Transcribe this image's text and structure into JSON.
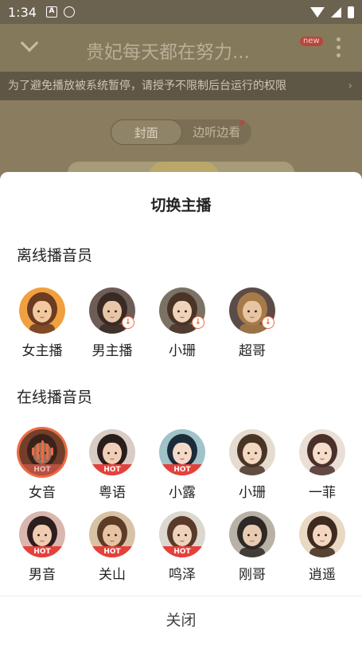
{
  "status": {
    "time": "1:34"
  },
  "header": {
    "title": "贵妃每天都在努力...",
    "badge": "new"
  },
  "notice": {
    "text": "为了避免播放被系统暂停，请授予不限制后台运行的权限",
    "arrow": "›"
  },
  "toggle": {
    "tab1": "封面",
    "tab2": "边听边看"
  },
  "sheet": {
    "title": "切换主播",
    "offline_title": "离线播音员",
    "online_title": "在线播音员",
    "hot_label": "HOT",
    "close_label": "关闭",
    "offline": [
      {
        "name": "女主播",
        "download": false,
        "skin": "#f2c89e",
        "hair": "#6b3b22",
        "bg": "#f0a040"
      },
      {
        "name": "男主播",
        "download": true,
        "skin": "#e8c7a8",
        "hair": "#3a2a24",
        "bg": "#6e5c57"
      },
      {
        "name": "小珊",
        "download": true,
        "skin": "#efd3bb",
        "hair": "#4a3428",
        "bg": "#7a7265"
      },
      {
        "name": "超哥",
        "download": true,
        "skin": "#e6c5a3",
        "hair": "#a77a4a",
        "bg": "#5b4c48"
      }
    ],
    "online": [
      {
        "name": "女音",
        "hot": true,
        "selected": true,
        "skin": "#e6b59a",
        "hair": "#3a2620",
        "bg": "#a05a3c"
      },
      {
        "name": "粤语",
        "hot": true,
        "selected": false,
        "skin": "#f0cfb8",
        "hair": "#2a1e1c",
        "bg": "#d8ccc5"
      },
      {
        "name": "小露",
        "hot": true,
        "selected": false,
        "skin": "#f4d9c9",
        "hair": "#1c2a3a",
        "bg": "#9fc3c8"
      },
      {
        "name": "小珊",
        "hot": false,
        "selected": false,
        "skin": "#f2d8c1",
        "hair": "#4a3426",
        "bg": "#e4ddcf"
      },
      {
        "name": "一菲",
        "hot": false,
        "selected": false,
        "skin": "#f5dccb",
        "hair": "#4a302a",
        "bg": "#e9dfd7"
      },
      {
        "name": "男音",
        "hot": true,
        "selected": false,
        "skin": "#efcbb2",
        "hair": "#2c1e1c",
        "bg": "#d9b7ae"
      },
      {
        "name": "关山",
        "hot": true,
        "selected": false,
        "skin": "#e6c3a2",
        "hair": "#5c3c26",
        "bg": "#d8c2a6"
      },
      {
        "name": "鸣泽",
        "hot": true,
        "selected": false,
        "skin": "#efd2bb",
        "hair": "#5a3a28",
        "bg": "#dcd8cf"
      },
      {
        "name": "刚哥",
        "hot": false,
        "selected": false,
        "skin": "#e8cbb3",
        "hair": "#2e2826",
        "bg": "#b8b2a6"
      },
      {
        "name": "逍遥",
        "hot": false,
        "selected": false,
        "skin": "#f1d6c0",
        "hair": "#3e2a1e",
        "bg": "#e8d8c4"
      }
    ]
  }
}
